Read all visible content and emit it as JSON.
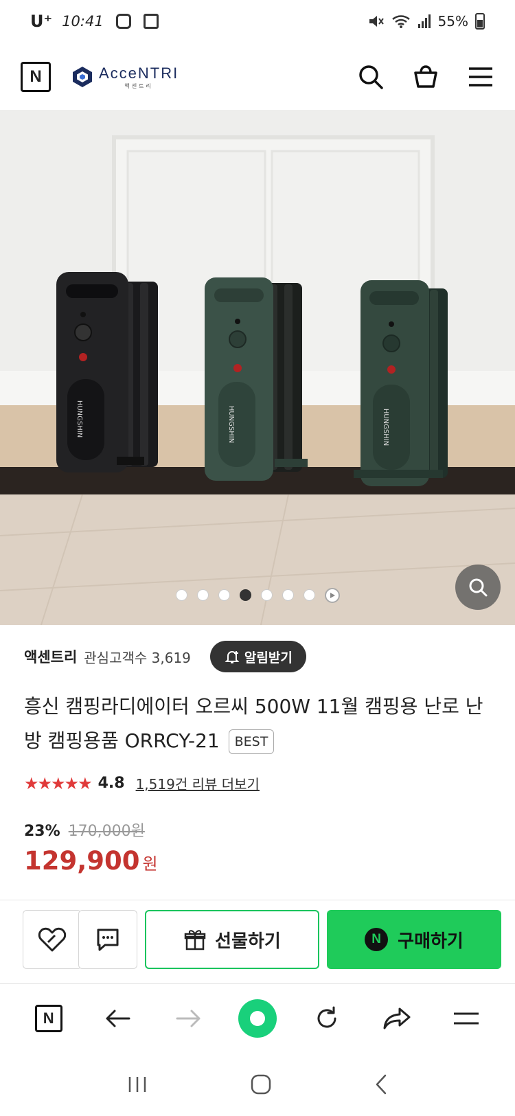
{
  "status_bar": {
    "carrier": "U⁺",
    "time": "10:41",
    "battery": "55%"
  },
  "header": {
    "n_label": "N",
    "logo_name": "AcceNTRI",
    "logo_sub": "액센트리"
  },
  "gallery": {
    "total_slides": 7,
    "active_index": 3,
    "heater_brand": "HUNGSHIN"
  },
  "store": {
    "brand": "액센트리",
    "watchers": "관심고객수 3,619",
    "alert_label": "알림받기"
  },
  "product": {
    "title": "흥신 캠핑라디에이터 오르씨 500W 11월 캠핑용 난로 난방 캠핑용품 ORRCY-21",
    "badge": "BEST",
    "stars": "★★★★★",
    "rating": "4.8",
    "reviews_link": "1,519건 리뷰 더보기",
    "discount": "23%",
    "original_price": "170,000원",
    "price": "129,900",
    "currency": "원"
  },
  "actions": {
    "gift_label": "선물하기",
    "buy_label": "구매하기",
    "buy_n": "N"
  },
  "toolbar": {
    "n_label": "N"
  },
  "colors": {
    "price_red": "#c4342f",
    "naver_green": "#1fcb5a",
    "star_red": "#e03a3a"
  }
}
